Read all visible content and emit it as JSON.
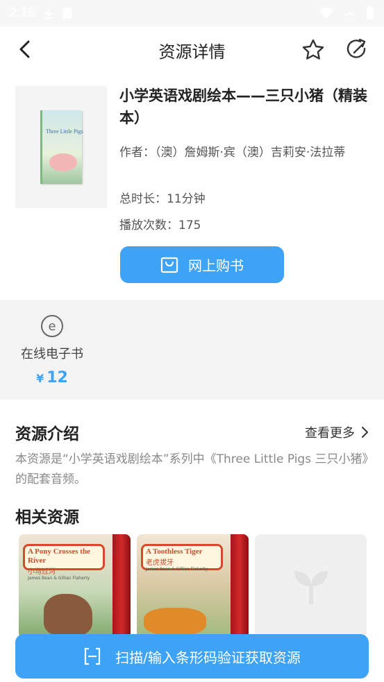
{
  "status_bar": {
    "time": "2:16"
  },
  "header": {
    "title": "资源详情",
    "back_icon": "chevron-left-icon",
    "favorite_icon": "star-icon",
    "share_icon": "share-icon"
  },
  "book": {
    "cover_title": "Three Little Pigs",
    "title": "小学英语戏剧绘本——三只小猪（精装本）",
    "author_label": "作者：",
    "author": "（澳）詹姆斯·宾（澳）吉莉安·法拉蒂",
    "duration_label": "总时长：",
    "duration": "11分钟",
    "plays_label": "播放次数：",
    "plays": "175",
    "buy_label": "网上购书"
  },
  "ebook": {
    "icon": "e",
    "label": "在线电子书",
    "currency": "¥",
    "price": "12"
  },
  "intro": {
    "title": "资源介绍",
    "more_label": "查看更多",
    "text": "本资源是“小学英语戏剧绘本”系列中《Three Little Pigs 三只小猪》的配套音频。"
  },
  "related": {
    "title": "相关资源",
    "items": [
      {
        "title_en": "A Pony Crosses the River",
        "title_cn": "小马过河",
        "authors": "James Bean & Gillian Flaherty"
      },
      {
        "title_en": "A Toothless Tiger",
        "title_cn": "老虎拔牙",
        "authors": "James Bean & Gillian Flaherty"
      }
    ]
  },
  "scan": {
    "label": "扫描/输入条形码验证获取资源"
  },
  "colors": {
    "accent": "#3ea3f5",
    "band": "#f3f3f3",
    "muted": "#888888"
  }
}
